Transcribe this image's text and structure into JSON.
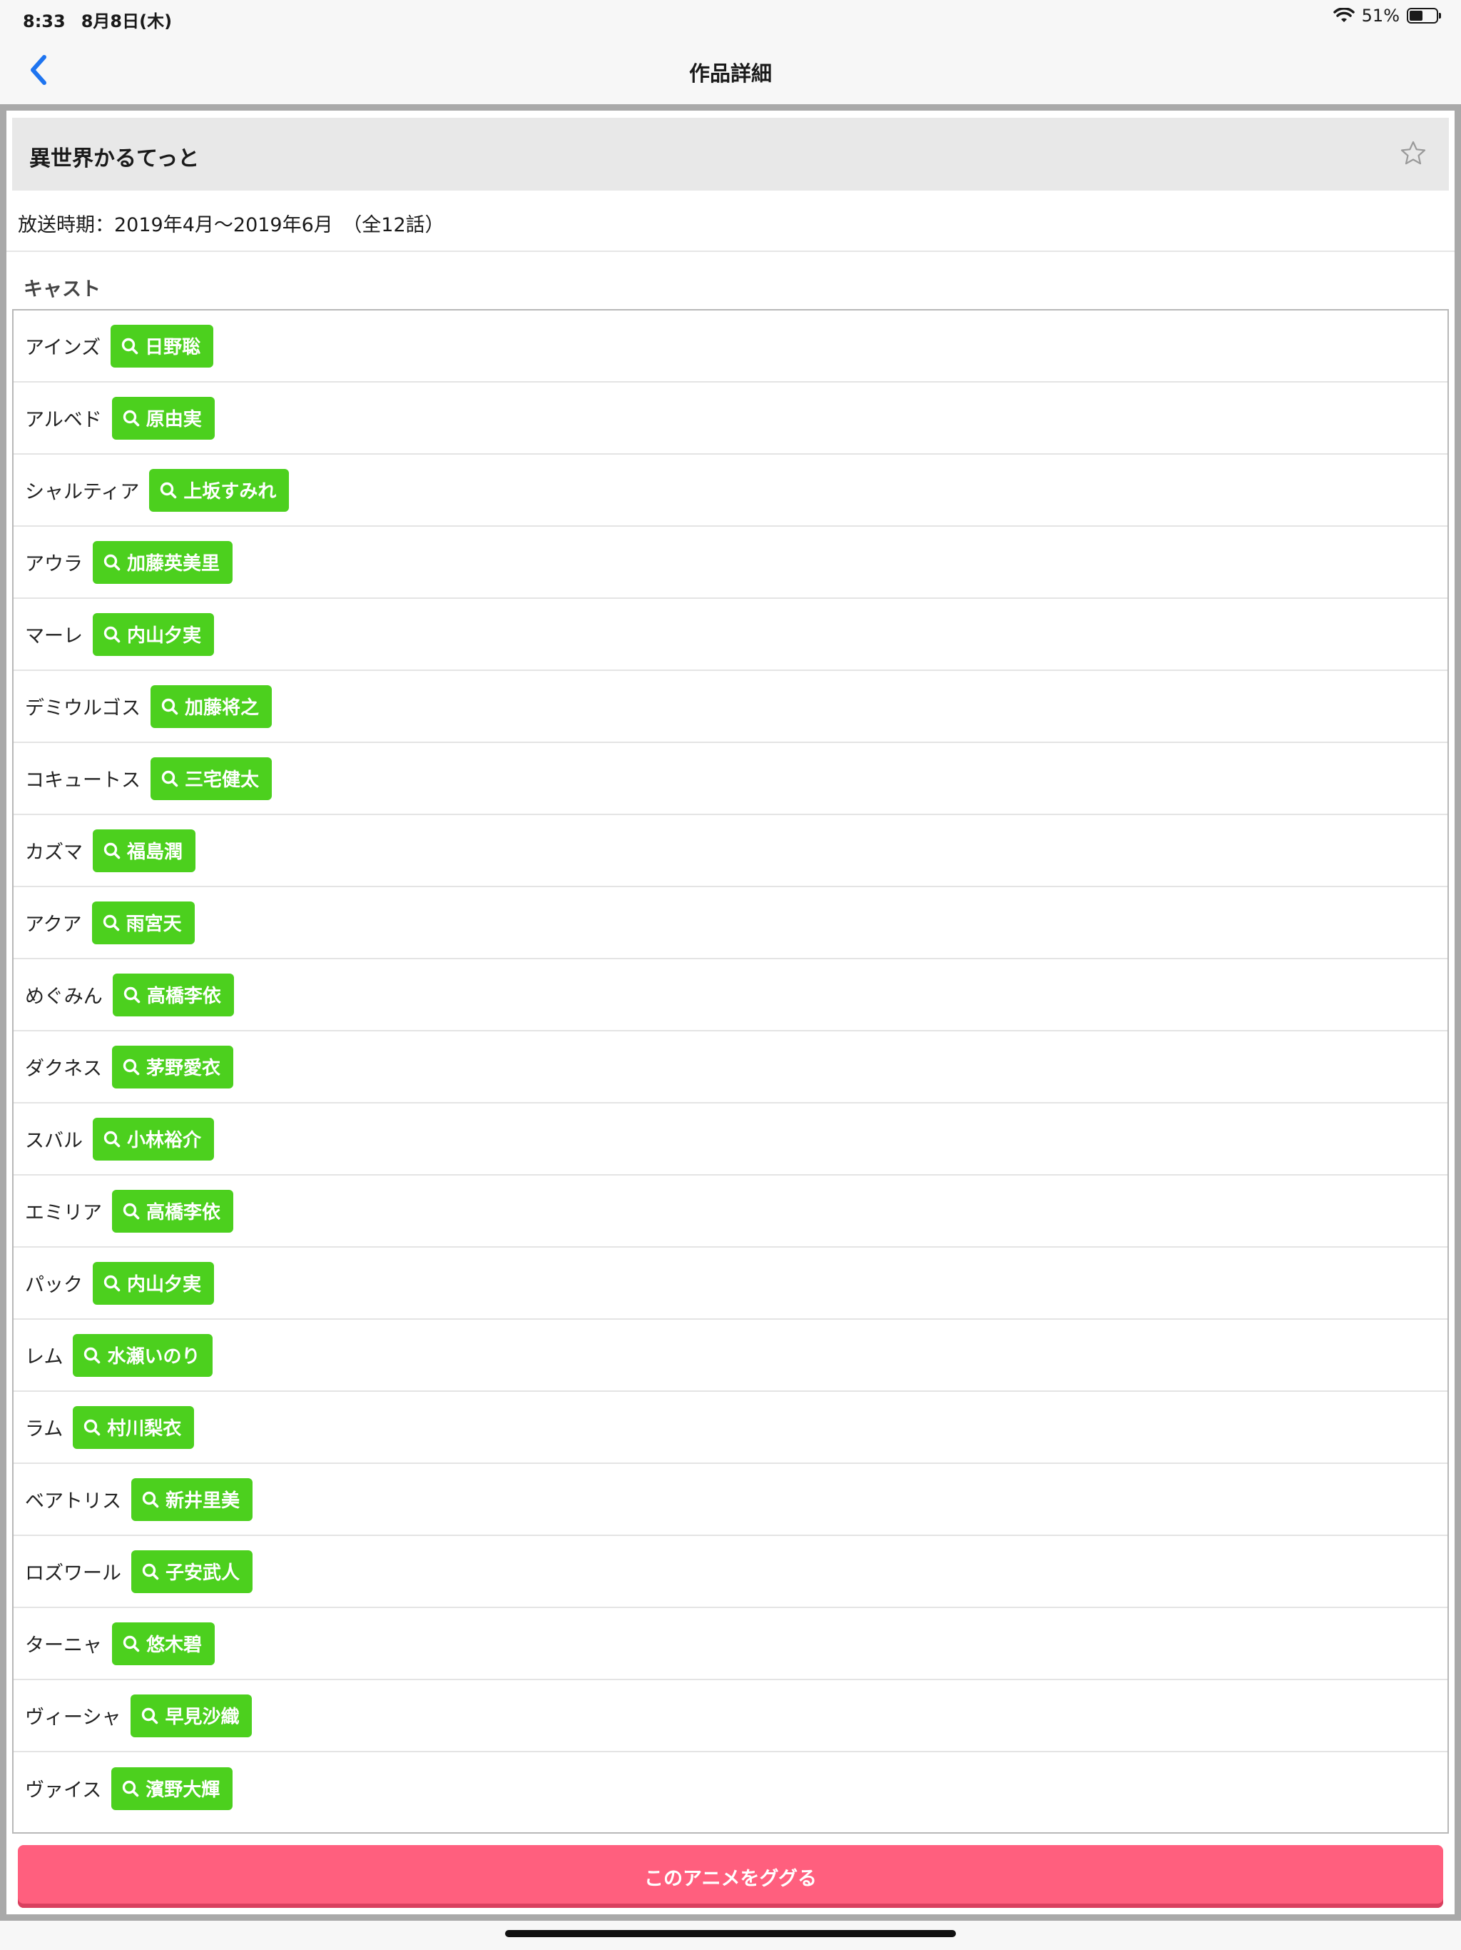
{
  "status_bar": {
    "time": "8:33",
    "date": "8月8日(木)",
    "battery": "51%",
    "icons": [
      "wifi-icon",
      "battery-icon"
    ]
  },
  "nav": {
    "title": "作品詳細",
    "back_icon": "chevron-left-icon"
  },
  "anime": {
    "title": "異世界かるてっと",
    "favorite_icon": "star-outline-icon",
    "broadcast": "放送時期：2019年4月〜2019年6月　（全12話）"
  },
  "cast": {
    "heading": "キャスト",
    "button_color": "#4cd01e",
    "items": [
      {
        "character": "アインズ",
        "actor": "日野聡"
      },
      {
        "character": "アルベド",
        "actor": "原由実"
      },
      {
        "character": "シャルティア",
        "actor": "上坂すみれ"
      },
      {
        "character": "アウラ",
        "actor": "加藤英美里"
      },
      {
        "character": "マーレ",
        "actor": "内山夕実"
      },
      {
        "character": "デミウルゴス",
        "actor": "加藤将之"
      },
      {
        "character": "コキュートス",
        "actor": "三宅健太"
      },
      {
        "character": "カズマ",
        "actor": "福島潤"
      },
      {
        "character": "アクア",
        "actor": "雨宮天"
      },
      {
        "character": "めぐみん",
        "actor": "高橋李依"
      },
      {
        "character": "ダクネス",
        "actor": "茅野愛衣"
      },
      {
        "character": "スバル",
        "actor": "小林裕介"
      },
      {
        "character": "エミリア",
        "actor": "高橋李依"
      },
      {
        "character": "パック",
        "actor": "内山夕実"
      },
      {
        "character": "レム",
        "actor": "水瀬いのり"
      },
      {
        "character": "ラム",
        "actor": "村川梨衣"
      },
      {
        "character": "ベアトリス",
        "actor": "新井里美"
      },
      {
        "character": "ロズワール",
        "actor": "子安武人"
      },
      {
        "character": "ターニャ",
        "actor": "悠木碧"
      },
      {
        "character": "ヴィーシャ",
        "actor": "早見沙織"
      },
      {
        "character": "ヴァイス",
        "actor": "濱野大輝"
      }
    ]
  },
  "google_button": {
    "label": "このアニメをググる",
    "color": "#ff5f7e"
  }
}
